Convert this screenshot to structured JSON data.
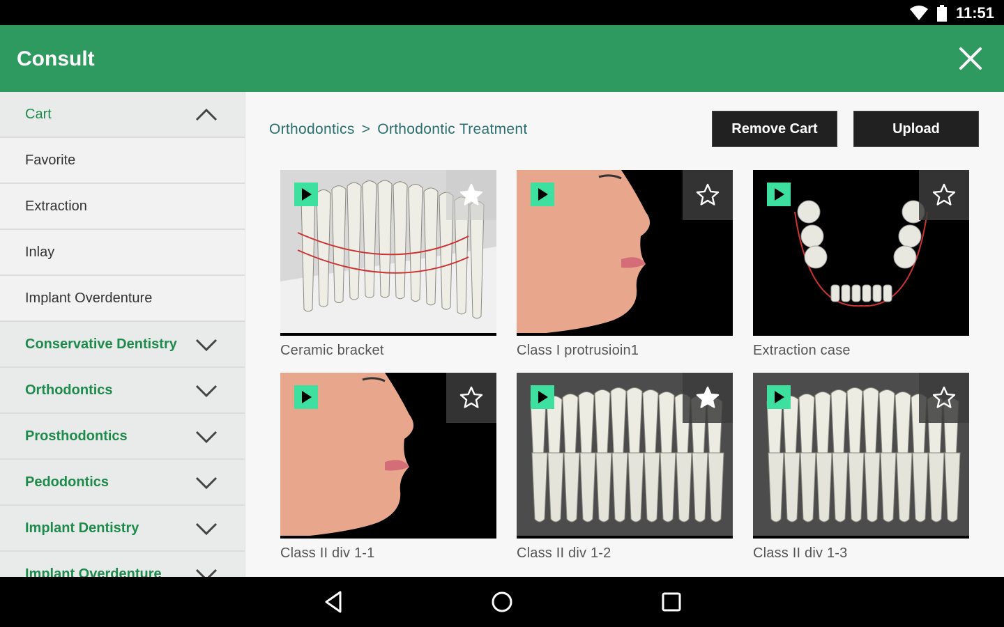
{
  "status_bar": {
    "time": "11:51",
    "wifi_icon": "wifi-icon",
    "battery_icon": "battery-icon"
  },
  "app_bar": {
    "title": "Consult",
    "close_icon": "close-icon"
  },
  "sidebar": {
    "items": [
      {
        "label": "Cart",
        "type": "cart",
        "chevron": "up"
      },
      {
        "label": "Favorite",
        "type": "sub"
      },
      {
        "label": "Extraction",
        "type": "sub"
      },
      {
        "label": "Inlay",
        "type": "sub"
      },
      {
        "label": "Implant Overdenture",
        "type": "sub"
      },
      {
        "label": "Conservative Dentistry",
        "type": "cat",
        "chevron": "down"
      },
      {
        "label": "Orthodontics",
        "type": "cat",
        "chevron": "down"
      },
      {
        "label": "Prosthodontics",
        "type": "cat",
        "chevron": "down"
      },
      {
        "label": "Pedodontics",
        "type": "cat",
        "chevron": "down"
      },
      {
        "label": "Implant Dentistry",
        "type": "cat",
        "chevron": "down"
      },
      {
        "label": "Implant Overdenture",
        "type": "cat",
        "chevron": "down"
      }
    ]
  },
  "breadcrumb": {
    "parent": "Orthodontics",
    "separator": ">",
    "current": "Orthodontic Treatment"
  },
  "actions": {
    "remove_cart": "Remove Cart",
    "upload": "Upload"
  },
  "videos": [
    {
      "caption": "Ceramic bracket",
      "favorited": true,
      "scene": "teeth-bracket"
    },
    {
      "caption": "Class I protrusioin1",
      "favorited": false,
      "scene": "face"
    },
    {
      "caption": "Extraction case",
      "favorited": false,
      "scene": "arch"
    },
    {
      "caption": "Class II div 1-1",
      "favorited": false,
      "scene": "face"
    },
    {
      "caption": "Class II div 1-2",
      "favorited": true,
      "scene": "teeth-gray"
    },
    {
      "caption": "Class II div 1-3",
      "favorited": false,
      "scene": "teeth-gray"
    }
  ],
  "colors": {
    "app_bar": "#2e9a5f",
    "category_text": "#1e8a4c",
    "play_badge": "#3ee0a0",
    "breadcrumb": "#2a6f6f"
  },
  "nav_bar": {
    "back_icon": "back-icon",
    "home_icon": "home-icon",
    "recents_icon": "recents-icon"
  }
}
